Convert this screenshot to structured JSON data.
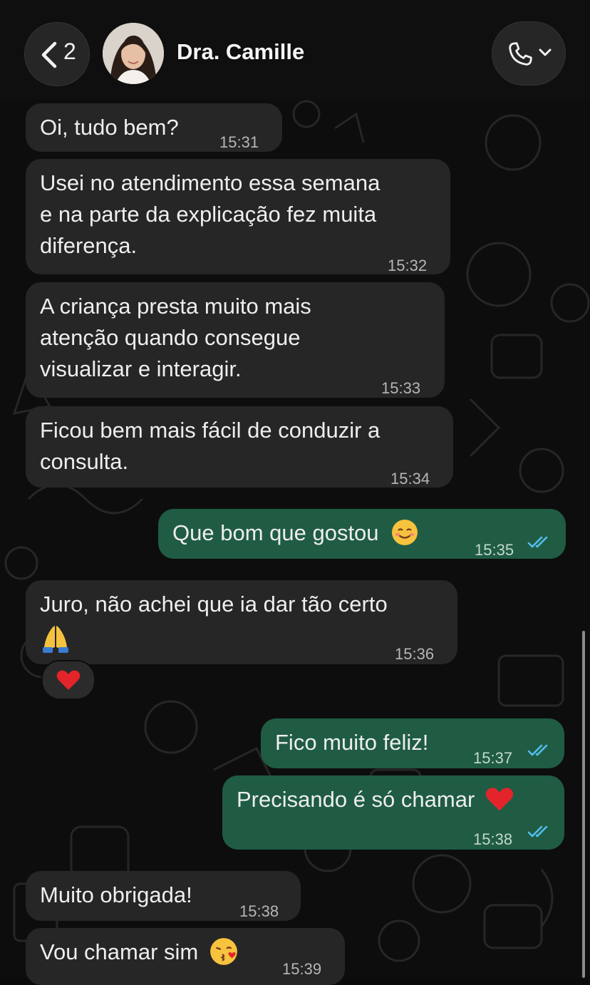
{
  "header": {
    "back_count": "2",
    "contact_name": "Dra. Camille",
    "back_icon": "chevron-left-icon",
    "call_icon": "phone-icon",
    "call_menu_icon": "chevron-down-icon"
  },
  "messages": [
    {
      "dir": "in",
      "text": "Oi, tudo bem?",
      "time": "15:31"
    },
    {
      "dir": "in",
      "text": "Usei no atendimento essa semana\ne na parte da explicação fez muita\ndiferença.",
      "time": "15:32"
    },
    {
      "dir": "in",
      "text": "A criança presta muito mais\natenção quando consegue\nvisualizar e interagir.",
      "time": "15:33"
    },
    {
      "dir": "in",
      "text": "Ficou bem mais fácil de conduzir a\nconsulta.",
      "time": "15:34"
    },
    {
      "dir": "out",
      "text": "Que bom que gostou",
      "emoji": "smiling-face-icon",
      "time": "15:35",
      "status": "read"
    },
    {
      "dir": "in",
      "text": "Juro, não achei que ia dar tão certo",
      "emoji": "folded-hands-icon",
      "time": "15:36",
      "reaction": "red-heart-icon"
    },
    {
      "dir": "out",
      "text": "Fico muito feliz!",
      "time": "15:37",
      "status": "read"
    },
    {
      "dir": "out",
      "text": "Precisando é só chamar",
      "emoji": "red-heart-icon",
      "time": "15:38",
      "status": "read"
    },
    {
      "dir": "in",
      "text": "Muito obrigada!",
      "time": "15:38"
    },
    {
      "dir": "in",
      "text": "Vou chamar sim",
      "emoji": "face-blowing-kiss-icon",
      "time": "15:39"
    }
  ],
  "colors": {
    "incoming_bubble": "#262626",
    "outgoing_bubble": "#1f5c43",
    "read_ticks": "#53bdeb",
    "background": "#0d0d0d"
  }
}
